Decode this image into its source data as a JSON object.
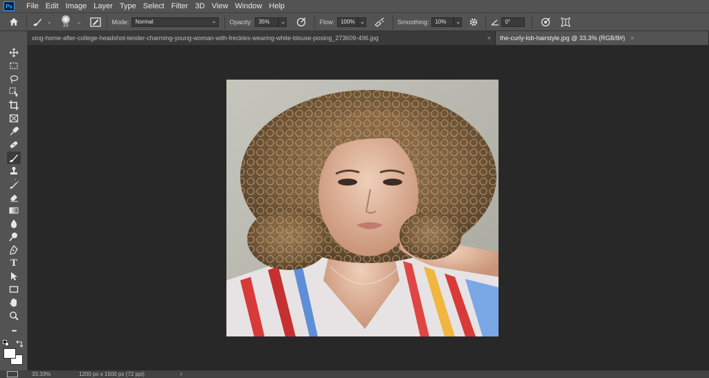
{
  "app": {
    "logo": "Ps"
  },
  "menu": [
    "File",
    "Edit",
    "Image",
    "Layer",
    "Type",
    "Select",
    "Filter",
    "3D",
    "View",
    "Window",
    "Help"
  ],
  "options": {
    "brush_size": "39",
    "mode_label": "Mode:",
    "mode_value": "Normal",
    "opacity_label": "Opacity:",
    "opacity_value": "35%",
    "flow_label": "Flow:",
    "flow_value": "100%",
    "smoothing_label": "Smoothing:",
    "smoothing_value": "10%",
    "angle_value": "0°"
  },
  "tabs": [
    {
      "label": "xing-home-after-college-headshot-tender-charming-young-woman-with-freckles-wearing-white-blouse-posing_273609-496.jpg",
      "close": "×"
    },
    {
      "label": "the-curly-lob-hairstyle.jpg @ 33.3% (RGB/8#)",
      "close": "×"
    }
  ],
  "toolbar": {
    "icons": [
      "move-icon",
      "marquee-icon",
      "lasso-icon",
      "object-select-icon",
      "crop-icon",
      "frame-icon",
      "eyedropper-icon",
      "healing-brush-icon",
      "brush-icon",
      "stamp-icon",
      "history-brush-icon",
      "eraser-icon",
      "gradient-icon",
      "blur-icon",
      "dodge-icon",
      "pen-icon",
      "type-icon",
      "path-select-icon",
      "rectangle-icon",
      "hand-icon",
      "zoom-icon",
      "more-icon"
    ],
    "active_tool": "brush-icon",
    "type_glyph": "T",
    "more_glyph": "•••",
    "foreground_color": "#ffffff",
    "background_color": "#ffffff"
  },
  "status": {
    "zoom": "33.33%",
    "doc_info": "1200 px x 1500 px (72 ppi)",
    "arrow": "›"
  }
}
